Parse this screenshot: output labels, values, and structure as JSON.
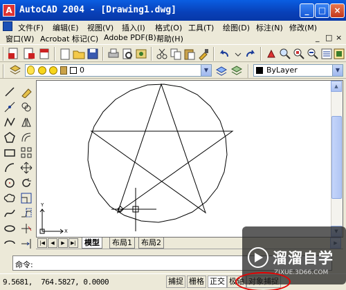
{
  "window": {
    "title": "AutoCAD 2004 - [Drawing1.dwg]",
    "logo": "autocad-logo-icon",
    "buttons": {
      "minimize": "_",
      "restore": "□",
      "close": "×"
    }
  },
  "menubar": {
    "row1": [
      "文件(F)",
      "编辑(E)",
      "视图(V)",
      "插入(I)",
      "格式(O)",
      "工具(T)",
      "绘图(D)",
      "标注(N)",
      "修改(M)"
    ],
    "row2": [
      "窗口(W)",
      "Acrobat 标记(C)",
      "Adobe PDF(B)",
      "帮助(H)"
    ],
    "doc_controls": {
      "minimize": "_",
      "restore": "□",
      "close": "×"
    }
  },
  "layerbar": {
    "layer_value": "0",
    "linetype_value": "ByLayer"
  },
  "tabs": {
    "model": "模型",
    "layout1": "布局1",
    "layout2": "布局2"
  },
  "command": {
    "prompt": "命令:"
  },
  "status": {
    "coordinates": "9.5681,  764.5827, 0.0000",
    "snap": "捕捉",
    "grid": "栅格",
    "ortho": "正交",
    "polar": "极轴",
    "osnap": "对象捕捉"
  },
  "ucs": {
    "x_label": "X",
    "y_label": "Y"
  },
  "watermark": {
    "title": "溜溜自学",
    "url": "ZIXUE.3D66.COM"
  },
  "colors": {
    "titlebar": "#0a5ee2",
    "highlight": "#e60000",
    "chrome": "#ece9d8"
  }
}
